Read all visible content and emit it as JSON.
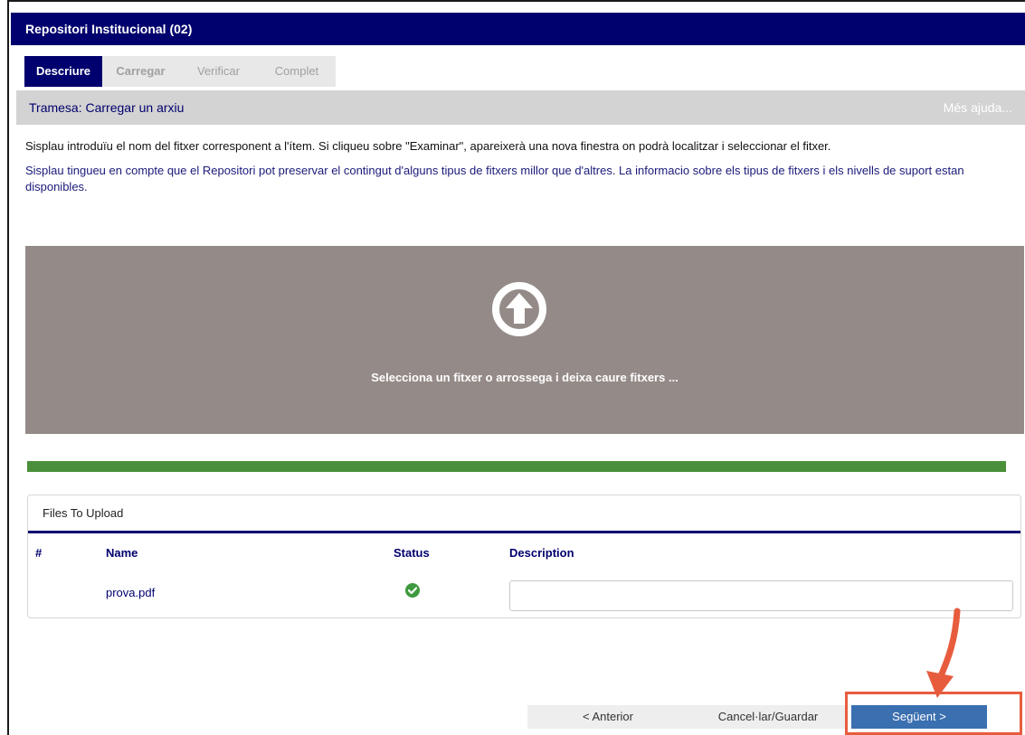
{
  "title": "Repositori Institucional (02)",
  "tabs": [
    {
      "label": "Descriure"
    },
    {
      "label": "Carregar"
    },
    {
      "label": "Verificar"
    },
    {
      "label": "Complet"
    }
  ],
  "section": {
    "title": "Tramesa: Carregar un arxiu",
    "help": "Més ajuda..."
  },
  "info": {
    "line1": "Sisplau introduïu el nom del fitxer corresponent a l'ítem. Si cliqueu sobre \"Examinar\", apareixerà una nova finestra on podrà localitzar i seleccionar el fitxer.",
    "line2": "Sisplau tingueu en compte que el Repositori pot preservar el contingut d'alguns tipus de fitxers millor que d'altres. La informacio sobre els tipus de fitxers i els nivells de suport estan disponibles."
  },
  "dropzone": {
    "text": "Selecciona un fitxer o arrossega i deixa caure fitxers ...",
    "icon": "upload-arrow-icon"
  },
  "progress": {
    "percent": 100,
    "color": "#4a8f3a"
  },
  "files": {
    "heading": "Files To Upload",
    "columns": {
      "index": "#",
      "name": "Name",
      "status": "Status",
      "description": "Description"
    },
    "rows": [
      {
        "name": "prova.pdf",
        "status_icon": "check-circle-icon",
        "description": ""
      }
    ]
  },
  "buttons": {
    "prev": "< Anterior",
    "cancel": "Cancel·lar/Guardar",
    "next": "Següent >"
  },
  "colors": {
    "brand": "#00006e",
    "accent": "#3a6fb0",
    "highlight": "#e85c3e",
    "success": "#4a8f3a"
  }
}
